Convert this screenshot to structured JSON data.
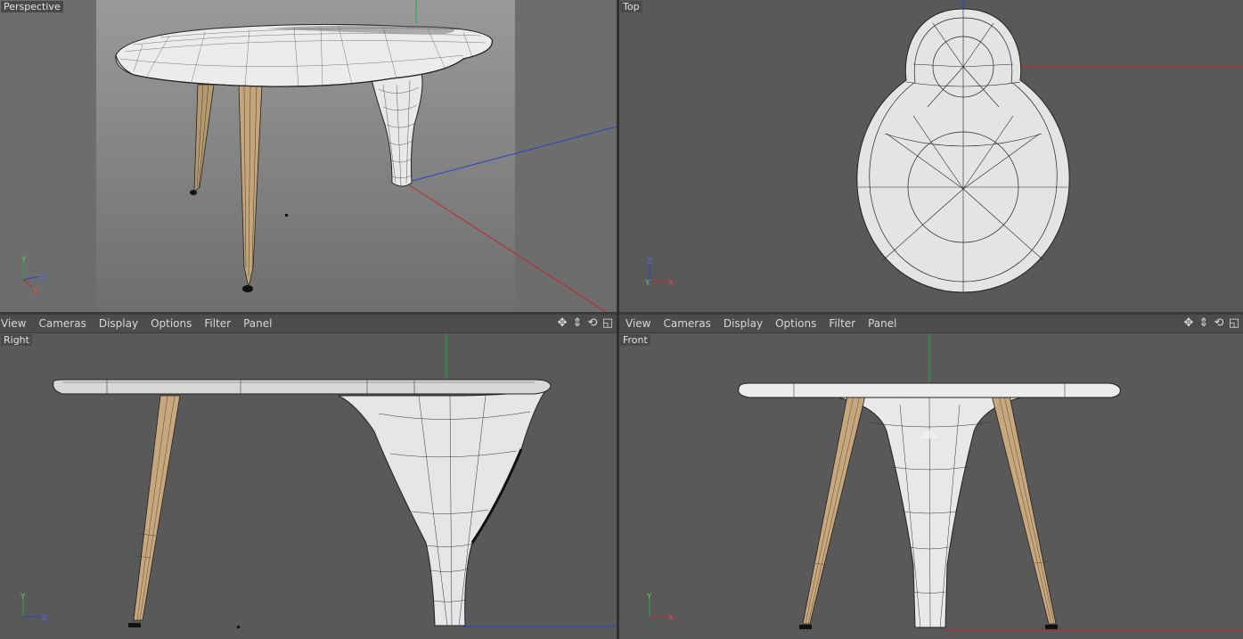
{
  "viewports": {
    "perspective": {
      "label": "Perspective"
    },
    "top": {
      "label": "Top"
    },
    "right": {
      "label": "Right"
    },
    "front": {
      "label": "Front"
    }
  },
  "menu_left": {
    "view": "View",
    "cameras": "Cameras",
    "display": "Display",
    "options": "Options",
    "filter": "Filter",
    "panel": "Panel"
  },
  "menu_right": {
    "view": "View",
    "cameras": "Cameras",
    "display": "Display",
    "options": "Options",
    "filter": "Filter",
    "panel": "Panel"
  },
  "axis_labels": {
    "perspective": {
      "up": "Y",
      "right": "Z",
      "depth": "X"
    },
    "top": {
      "up": "Z",
      "right": "X",
      "depth": "Y"
    },
    "right": {
      "up": "Y",
      "right": "Z"
    },
    "front": {
      "up": "Y",
      "right": "X"
    }
  },
  "nav_icons": [
    "move-icon",
    "zoom-icon",
    "rotate-icon",
    "maximize-icon"
  ],
  "colors": {
    "axis_x": "#c0262c",
    "axis_y": "#22a83c",
    "axis_z": "#2b3fc4",
    "mesh_fill": "#e4e4e4",
    "wood": "#c9a77c"
  }
}
